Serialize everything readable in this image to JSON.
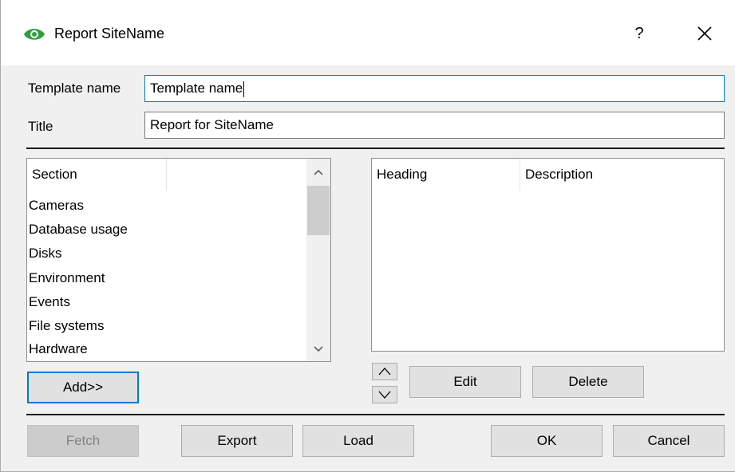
{
  "window": {
    "title": "Report SiteName",
    "help_label": "?"
  },
  "form": {
    "template_name_label": "Template name",
    "template_name_value": "Template name",
    "title_label": "Title",
    "title_value": "Report for SiteName"
  },
  "sections_list": {
    "header": "Section",
    "items": [
      "Cameras",
      "Database usage",
      "Disks",
      "Environment",
      "Events",
      "File systems",
      "Hardware"
    ]
  },
  "report_list": {
    "headers": [
      "Heading",
      "Description"
    ]
  },
  "buttons": {
    "add": "Add>>",
    "edit": "Edit",
    "delete": "Delete",
    "fetch": "Fetch",
    "export": "Export",
    "load": "Load",
    "ok": "OK",
    "cancel": "Cancel"
  },
  "icons": {
    "app": "eye-icon",
    "help": "help-icon",
    "close": "close-icon",
    "move_up": "chevron-up-icon",
    "move_down": "chevron-down-icon"
  },
  "colors": {
    "app_icon": "#2e9e3e",
    "focus_border": "#0078d7"
  }
}
